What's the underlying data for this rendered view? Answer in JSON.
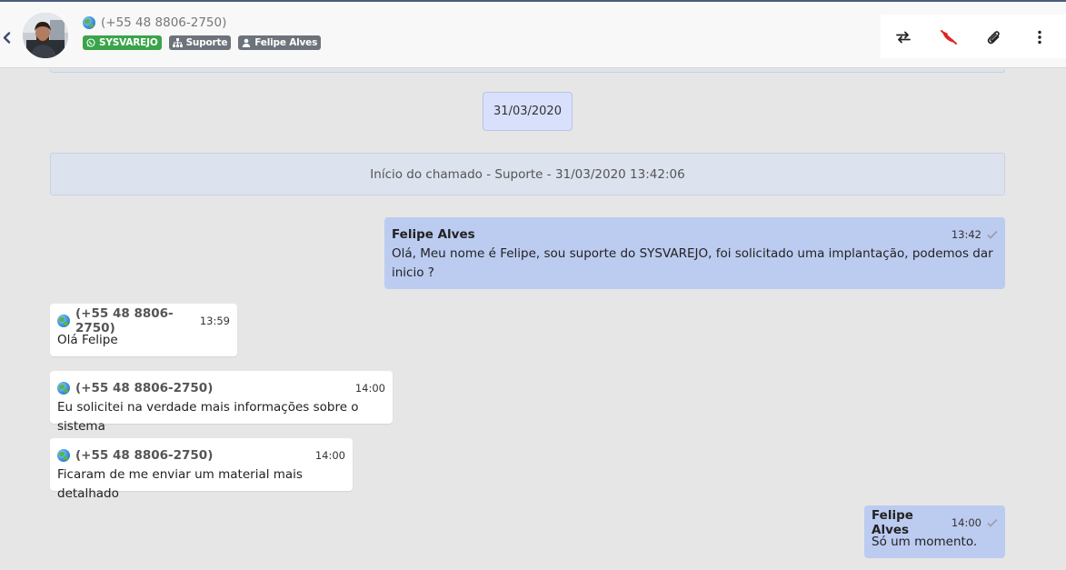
{
  "header": {
    "contact_phone": "(+55 48 8806-2750)",
    "tags": [
      {
        "label": "SYSVAREJO",
        "icon": "whatsapp-icon",
        "color": "#3aa44a"
      },
      {
        "label": "Suporte",
        "icon": "sitemap-icon",
        "color": "#6d737a"
      },
      {
        "label": "Felipe Alves",
        "icon": "user-icon",
        "color": "#6d737a"
      }
    ],
    "actions": [
      {
        "icon": "transfer-icon"
      },
      {
        "icon": "end-call-icon",
        "color": "#e02020"
      },
      {
        "icon": "paperclip-icon"
      },
      {
        "icon": "more-vertical-icon"
      }
    ]
  },
  "chat": {
    "date_separator": "31/03/2020",
    "ticket_start": "Início do chamado - Suporte - 31/03/2020 13:42:06",
    "messages": [
      {
        "direction": "out",
        "sender": "Felipe Alves",
        "time": "13:42",
        "text": "Olá, Meu nome é Felipe, sou suporte do SYSVAREJO, foi solicitado uma implantação, podemos dar inicio ?"
      },
      {
        "direction": "in",
        "sender": "(+55 48 8806-2750)",
        "time": "13:59",
        "text": "Olá Felipe"
      },
      {
        "direction": "in",
        "sender": "(+55 48 8806-2750)",
        "time": "14:00",
        "text": "Eu solicitei na verdade mais informações sobre o sistema"
      },
      {
        "direction": "in",
        "sender": "(+55 48 8806-2750)",
        "time": "14:00",
        "text": "Ficaram de me enviar um material mais detalhado"
      },
      {
        "direction": "out",
        "sender": "Felipe Alves",
        "time": "14:00",
        "text": "Só um momento."
      }
    ]
  },
  "colors": {
    "accent": "#3d4a70",
    "outgoing_bubble": "#bccbf0",
    "incoming_bubble": "#ffffff",
    "background": "#e6e6e6"
  }
}
